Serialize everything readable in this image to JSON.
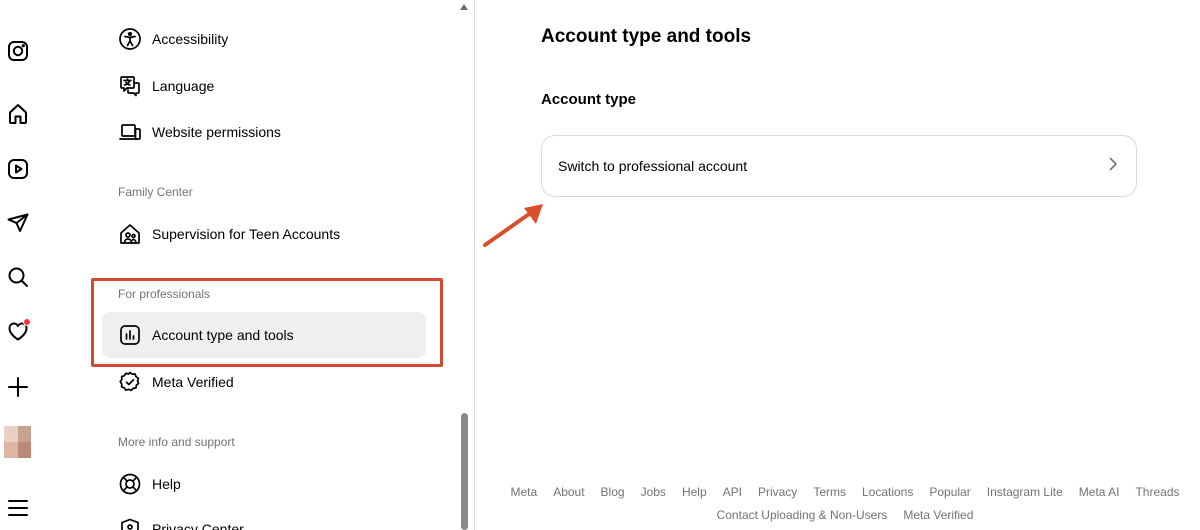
{
  "rail": {
    "items": [
      {
        "name": "instagram-logo-icon"
      },
      {
        "name": "home-icon"
      },
      {
        "name": "reels-icon"
      },
      {
        "name": "messages-icon"
      },
      {
        "name": "search-icon"
      },
      {
        "name": "notifications-icon"
      },
      {
        "name": "create-icon"
      },
      {
        "name": "profile-avatar"
      },
      {
        "name": "menu-icon"
      }
    ]
  },
  "sidebar": {
    "accessibility_label": "Accessibility",
    "language_label": "Language",
    "website_permissions_label": "Website permissions",
    "family_center_heading": "Family Center",
    "supervision_label": "Supervision for Teen Accounts",
    "for_professionals_heading": "For professionals",
    "account_type_label": "Account type and tools",
    "meta_verified_label": "Meta Verified",
    "more_info_heading": "More info and support",
    "help_label": "Help",
    "privacy_center_label": "Privacy Center"
  },
  "main": {
    "title": "Account type and tools",
    "section_title": "Account type",
    "switch_label": "Switch to professional account"
  },
  "footer": {
    "row1": [
      "Meta",
      "About",
      "Blog",
      "Jobs",
      "Help",
      "API",
      "Privacy",
      "Terms",
      "Locations",
      "Popular",
      "Instagram Lite",
      "Meta AI",
      "Threads"
    ],
    "row2": [
      "Contact Uploading & Non-Users",
      "Meta Verified"
    ]
  },
  "colors": {
    "highlight": "#cf4a2e",
    "notification_dot": "#ff3040",
    "active_bg": "#efefef"
  }
}
